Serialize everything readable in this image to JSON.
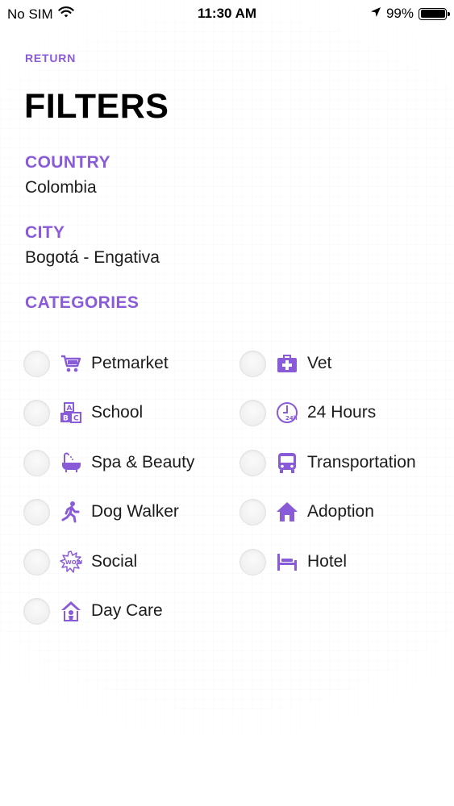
{
  "status_bar": {
    "carrier": "No SIM",
    "time": "11:30 AM",
    "battery": "99%",
    "icons": [
      "wifi-icon",
      "location-arrow-icon",
      "battery-icon"
    ]
  },
  "nav": {
    "return_label": "RETURN"
  },
  "title": "FILTERS",
  "country": {
    "label": "COUNTRY",
    "value": "Colombia"
  },
  "city": {
    "label": "CITY",
    "value": "Bogotá - Engativa"
  },
  "categories": {
    "label": "CATEGORIES",
    "items": [
      {
        "label": "Petmarket",
        "icon": "shopping-cart-icon",
        "checked": false
      },
      {
        "label": "Vet",
        "icon": "medical-kit-icon",
        "checked": false
      },
      {
        "label": "School",
        "icon": "abc-blocks-icon",
        "checked": false
      },
      {
        "label": "24 Hours",
        "icon": "clock-24h-icon",
        "checked": false
      },
      {
        "label": "Spa & Beauty",
        "icon": "bathtub-icon",
        "checked": false
      },
      {
        "label": "Transportation",
        "icon": "bus-icon",
        "checked": false
      },
      {
        "label": "Dog Walker",
        "icon": "walking-person-icon",
        "checked": false
      },
      {
        "label": "Adoption",
        "icon": "house-icon",
        "checked": false
      },
      {
        "label": "Social",
        "icon": "wow-burst-icon",
        "checked": false
      },
      {
        "label": "Hotel",
        "icon": "bed-icon",
        "checked": false
      },
      {
        "label": "Day Care",
        "icon": "dog-house-icon",
        "checked": false
      }
    ]
  },
  "colors": {
    "accent": "#8a5bd8",
    "text": "#1c1c1e"
  }
}
